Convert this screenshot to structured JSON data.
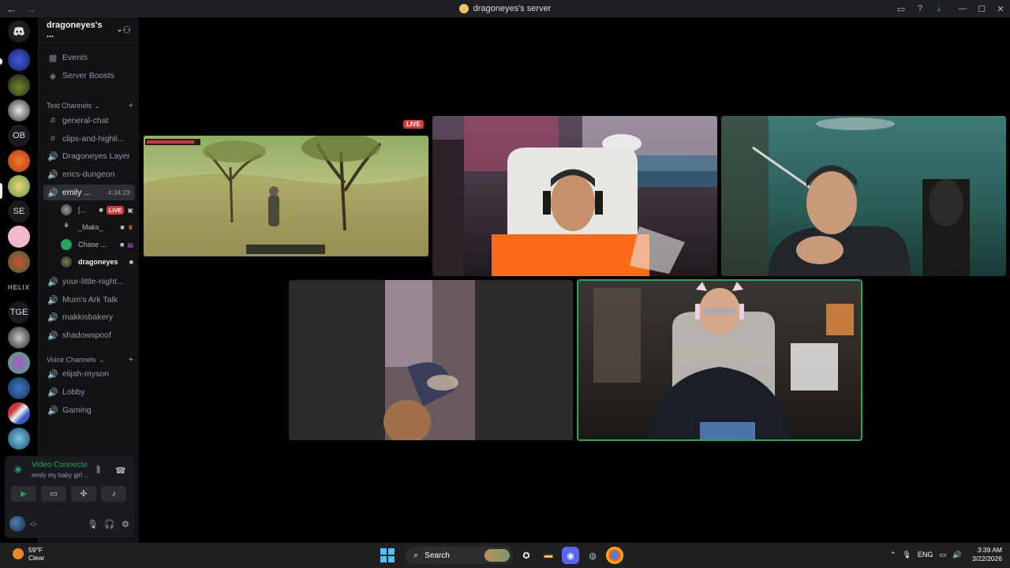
{
  "titlebar": {
    "back_icon": "←",
    "forward_icon": "→",
    "title": "dragoneyes's server",
    "inbox_icon": "▭",
    "help_icon": "?",
    "download_icon": "⤓",
    "minimize_icon": "—",
    "maximize_icon": "☐",
    "close_icon": "✕"
  },
  "rail": {
    "home_icon": "discord-logo",
    "text_servers": [
      "OB",
      "SE",
      "TGE"
    ],
    "helix_label": "HELIX"
  },
  "sidebar": {
    "server_name": "dragoneyes's ...",
    "chevron": "⌄",
    "invite_icon": "⚇",
    "events": "Events",
    "boosts": "Server Boosts",
    "text_category": "Text Channels",
    "voice_category": "Voice Channels",
    "plus": "+",
    "channels": [
      {
        "icon": "#",
        "name": "general-chat"
      },
      {
        "icon": "#",
        "name": "clips-and-highli..."
      },
      {
        "icon": "🔊",
        "name": "Dragoneyes Layer"
      },
      {
        "icon": "🔊",
        "name": "erics-dungeon"
      },
      {
        "icon": "🔊",
        "name": "emily ...",
        "time": "4:34:23"
      },
      {
        "icon": "🔊",
        "name": "your-little-night..."
      },
      {
        "icon": "🔊",
        "name": "Mum's Ark Talk"
      },
      {
        "icon": "🔊",
        "name": "makkisbakery"
      },
      {
        "icon": "🔊",
        "name": "shadowspoof"
      }
    ],
    "voice_channels": [
      {
        "icon": "🔊",
        "name": "elijah-myson"
      },
      {
        "icon": "🔊",
        "name": "Lobby"
      },
      {
        "icon": "🔊",
        "name": "Gaming"
      }
    ],
    "voice_users": [
      {
        "name": "[...",
        "badge": "LIVE",
        "icon": "■"
      },
      {
        "name": "_Maks_",
        "icon": "■"
      },
      {
        "name": "Chase ...",
        "icon": "■"
      },
      {
        "name": "dragoneyes",
        "icon": "■"
      }
    ]
  },
  "voice_panel": {
    "status": "Video Connecte",
    "channel": "emily my baby girl ...",
    "username": "-:-",
    "buttons": [
      "camera",
      "screen-share",
      "activities",
      "soundboard"
    ]
  },
  "stream": {
    "live_label": "LIVE"
  },
  "taskbar": {
    "temperature": "59°F",
    "condition": "Clear",
    "search_label": "Search",
    "tray_lang": "ENG",
    "time": "3:39 AM",
    "date": "3/22/2026"
  },
  "colors": {
    "speaking": "#23a55a",
    "live": "#da373c",
    "sidebar_bg": "#121214"
  }
}
